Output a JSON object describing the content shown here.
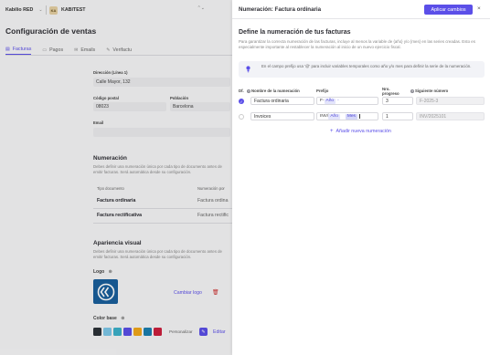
{
  "background": {
    "company": "Kabilio RED",
    "workspace_initials": "KA",
    "workspace_name": "KABITEST",
    "page_title": "Configuración de ventas",
    "tabs": [
      {
        "label": "Facturas",
        "active": true
      },
      {
        "label": "Pagos",
        "active": false
      },
      {
        "label": "Emails",
        "active": false
      },
      {
        "label": "Verifactu",
        "active": false
      }
    ],
    "address": {
      "label": "Dirección (Línea 1)",
      "value": "Calle Mayor, 132"
    },
    "postal_code": {
      "label": "Código postal",
      "value": "08023"
    },
    "population": {
      "label": "Población",
      "value": "Barcelona"
    },
    "email": {
      "label": "Email",
      "value": ""
    },
    "numbering": {
      "title": "Numeración",
      "description": "Debes definir una numeración única por cada tipo de documento antes de emitir facturas. Será automática desde su configuración.",
      "col_type": "Tipo documento",
      "col_numbering": "Numeración por",
      "rows": [
        {
          "type": "Factura ordinaria",
          "numbering": "Factura ordina"
        },
        {
          "type": "Factura rectificativa",
          "numbering": "Factura rectific"
        }
      ]
    },
    "visual": {
      "title": "Apariencia visual",
      "description": "Debes definir una numeración única por cada tipo de documento antes de emitir facturas. Será automática desde su configuración.",
      "logo_label": "Logo",
      "change_logo": "Cambiar logo",
      "base_color_label": "Color base",
      "swatches": [
        "#2c3138",
        "#7dc7e8",
        "#3cb0c9",
        "#5b4fe8",
        "#f1a81b",
        "#1b7fb0",
        "#cc1f3d"
      ],
      "customize_label": "Personalizar",
      "edit_label": "Editar"
    }
  },
  "panel": {
    "title": "Numeración: Factura ordinaria",
    "apply_button": "Aplicar cambios",
    "close_glyph": "×",
    "heading": "Define la numeración de tus facturas",
    "description": "Para garantizar la correcta numeración de las facturas, incluye al menos la variable de {año} y/o {mes} en las series creadas. Esto es especialmente importante al restablecer la numeración al inicio de un nuevo ejercicio fiscal.",
    "info_text": "En el campo prefijo usa '@' para incluir variables temporales como año y/o mes para definir la serie de la numeración.",
    "columns": {
      "default": "Df.",
      "name": "Nombre de la numeración",
      "prefix": "Prefijo",
      "next_progress": "Nro. progreso",
      "next_number": "Siguiente número"
    },
    "rows": [
      {
        "selected": true,
        "name": "Factura ordinaria",
        "prefix_static": "F-",
        "prefix_vars": [
          "Año",
          "-"
        ],
        "progress": "3",
        "next": "F-2025-3"
      },
      {
        "selected": false,
        "name": "Invoices",
        "prefix_static": "INV/",
        "prefix_vars": [
          "Año",
          "Mes"
        ],
        "progress": "1",
        "next": "INV/2025101"
      }
    ],
    "add_label": "Añadir nueva numeración"
  }
}
